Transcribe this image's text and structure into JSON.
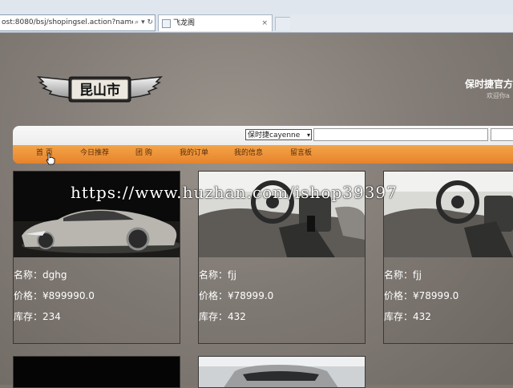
{
  "browser": {
    "address_url": "ost:8080/bsj/shopingsel.action?name",
    "address_controls": "⌕ ▾ ↻",
    "tab_title": "飞龙阁",
    "tab_close": "×"
  },
  "header": {
    "logo_text": "昆山市",
    "brand_text": "保时捷官方",
    "welcome_text": "欢迎你a"
  },
  "search": {
    "selected_option": "保时捷cayenne",
    "query": ""
  },
  "nav": {
    "items": [
      "首 页",
      "今日推荐",
      "团 购",
      "我的订单",
      "我的信息",
      "留言板"
    ]
  },
  "products": [
    {
      "name_label": "名称：",
      "name": "dghg",
      "price_label": "价格：",
      "price": "¥899990.0",
      "stock_label": "库存：",
      "stock": "234"
    },
    {
      "name_label": "名称：",
      "name": "fjj",
      "price_label": "价格：",
      "price": "¥78999.0",
      "stock_label": "库存：",
      "stock": "432"
    },
    {
      "name_label": "名称：",
      "name": "fjj",
      "price_label": "价格：",
      "price": "¥78999.0",
      "stock_label": "库存：",
      "stock": "432"
    }
  ],
  "watermark": "https://www.huzhan.com/ishop39397",
  "colors": {
    "nav_orange": "#e98a33",
    "page_bg": "#857e78",
    "card_text": "#ffffff"
  }
}
